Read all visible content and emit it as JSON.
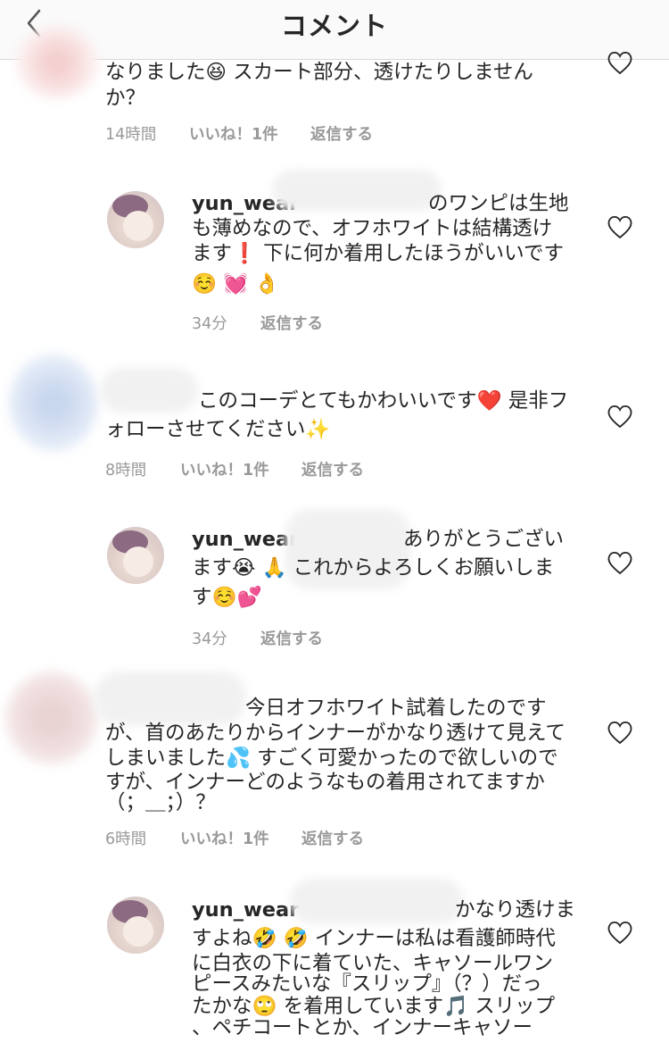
{
  "header": {
    "title": "コメント"
  },
  "comments": [
    {
      "lines": [
        "なりました😆 スカート部分、透けたりしません",
        "か？"
      ],
      "time": "14時間",
      "likes": "いいね！1件",
      "reply": "返信する"
    },
    {
      "username": "yun_wear",
      "lines": [
        "のワンピは生地",
        "も薄めなので、オフホワイトは結構透け",
        "ます❗ 下に何か着用したほうがいいです",
        "☺️ 💓 👌"
      ],
      "time": "34分",
      "reply": "返信する"
    },
    {
      "lines": [
        "このコーデとてもかわいいです❤️ 是非フ",
        "ォローさせてください✨"
      ],
      "time": "8時間",
      "likes": "いいね！1件",
      "reply": "返信する"
    },
    {
      "username": "yun_wear",
      "lines": [
        "ありがとうござい",
        "ます😭 🙏 これからよろしくお願いしま",
        "す☺️💕"
      ],
      "time": "34分",
      "reply": "返信する"
    },
    {
      "lines": [
        "今日オフホワイト試着したのです",
        "が、首のあたりからインナーがかなり透けて見えて",
        "しまいました💦 すごく可愛かったので欲しいので",
        "すが、インナーどのようなもの着用されてますか",
        "（；＿；）？"
      ],
      "time": "6時間",
      "likes": "いいね！1件",
      "reply": "返信する"
    },
    {
      "username": "yun_wear",
      "lines": [
        "かなり透けま",
        "すよね🤣 🤣 インナーは私は看護師時代",
        "に白衣の下に着ていた、キャソールワン",
        "ピースみたいな『スリップ』（？）だっ",
        "たかな🙄 を着用しています🎵 スリップ",
        "、ペチコートとか、インナーキャソー"
      ]
    }
  ],
  "colors": {
    "text": "#262626",
    "meta": "#999999",
    "header_bg": "#fafafa",
    "heart": "#262626"
  },
  "icons": {
    "back": "chevron-left-icon",
    "like": "heart-outline-icon"
  }
}
